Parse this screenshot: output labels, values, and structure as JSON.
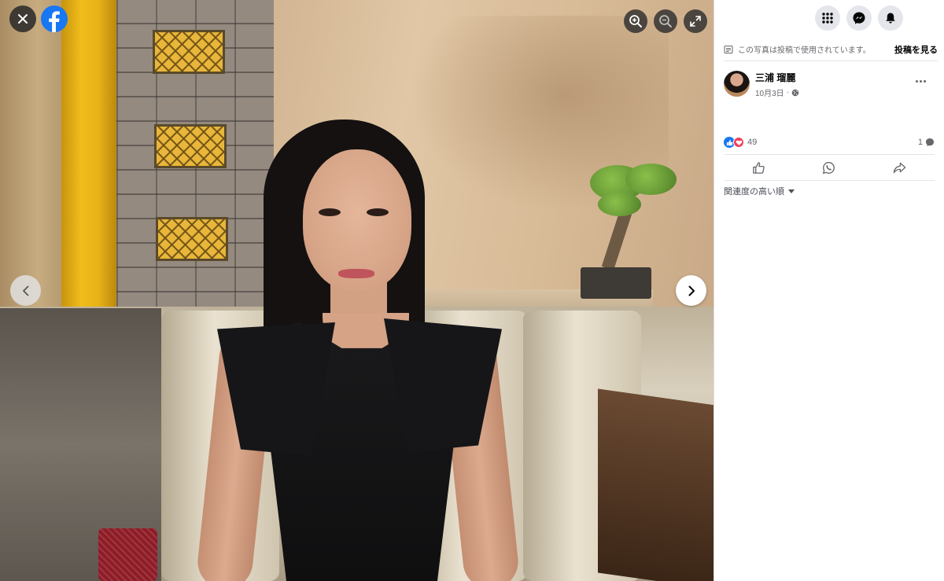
{
  "viewer": {
    "photo_alt": "",
    "controls": {
      "close": "close-icon",
      "logo": "facebook-logo",
      "zoom_in": "zoom-in-icon",
      "zoom_out": "zoom-out-icon",
      "fullscreen": "fullscreen-icon",
      "previous": "chevron-left-icon",
      "next": "chevron-right-icon"
    }
  },
  "header": {
    "icons": [
      "apps-grid-icon",
      "messenger-icon",
      "bell-icon"
    ]
  },
  "notice": {
    "text": "この写真は投稿で使用されています。",
    "link": "投稿を見る"
  },
  "post": {
    "author": "三浦 瑠麗",
    "date": "10月3日",
    "separator": "·",
    "privacy_icon": "globe-icon"
  },
  "reactions": {
    "types": [
      "like",
      "love"
    ],
    "count": "49",
    "comments": "1"
  },
  "actions": [
    "like-icon",
    "whatsapp-icon",
    "share-icon"
  ],
  "comments_sort": {
    "label": "関連度の高い順"
  },
  "colors": {
    "brand": "#1877f2",
    "love": "#f33e58",
    "icon_bg": "#e4e6eb"
  }
}
